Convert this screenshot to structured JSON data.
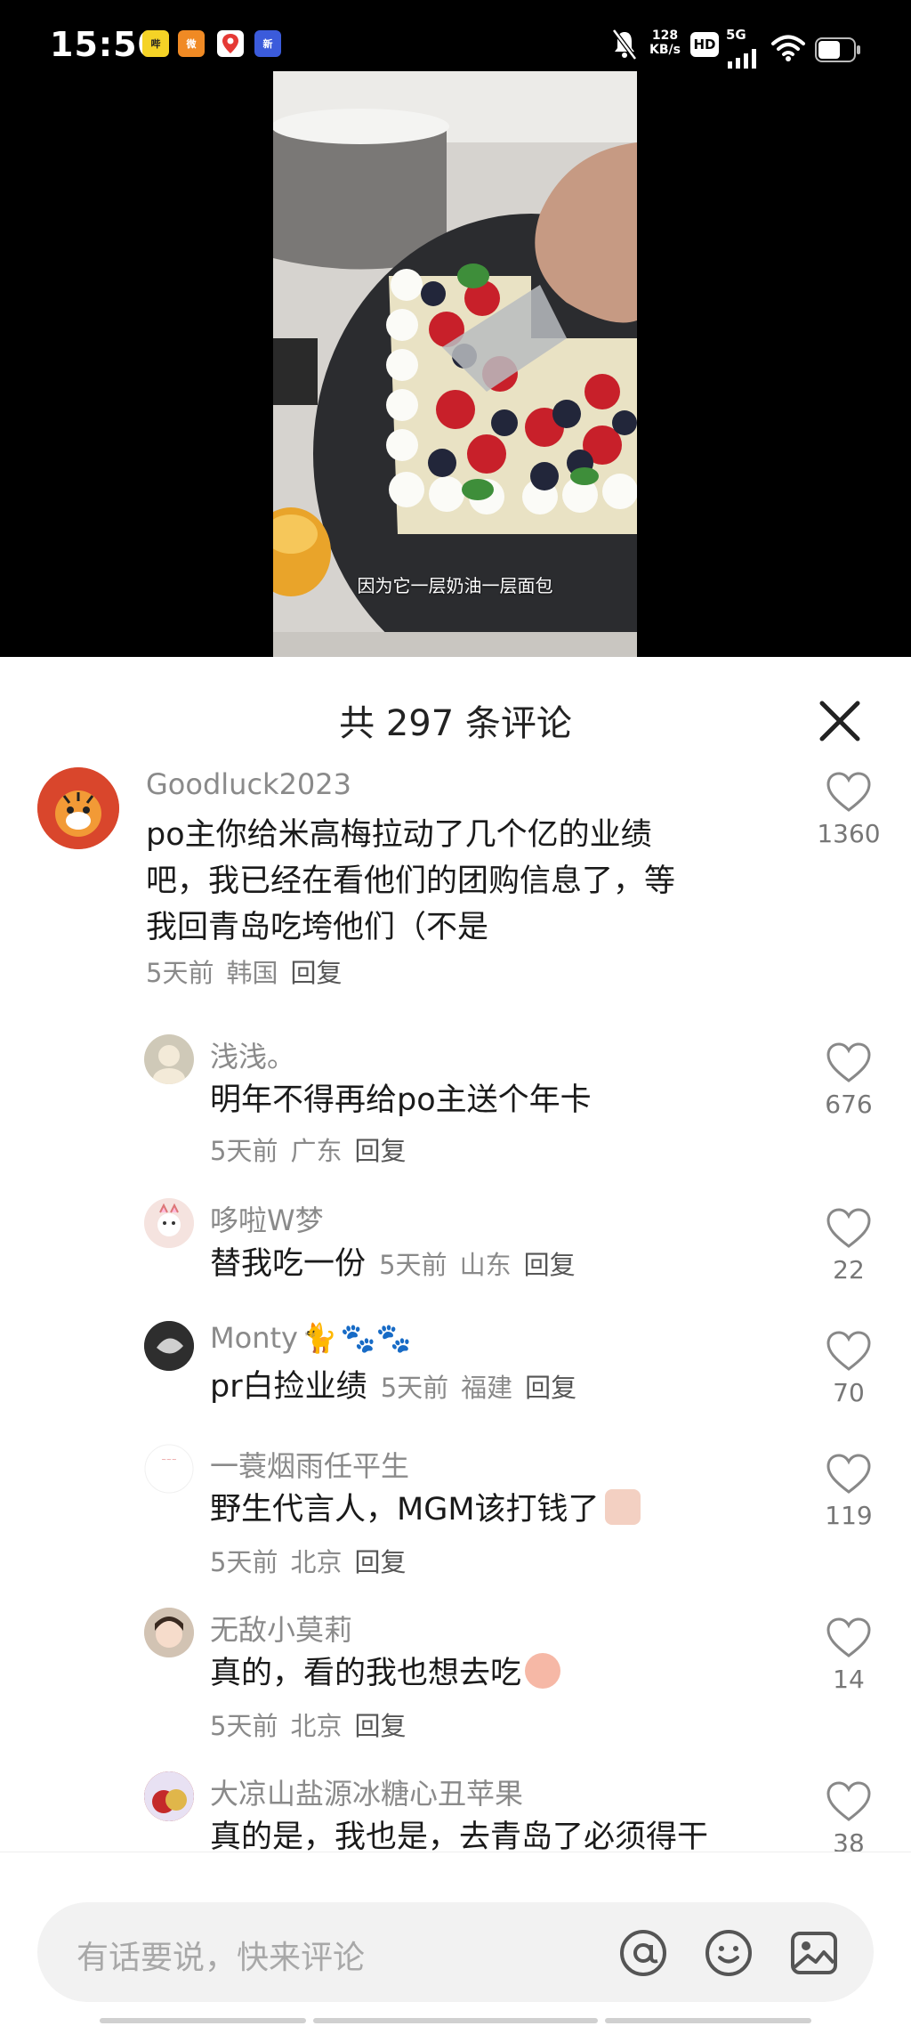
{
  "status_bar": {
    "time": "15:50",
    "app_icons": [
      "bilibili-icon",
      "weibo-icon",
      "map-pin-icon",
      "app-icon"
    ],
    "net_speed_value": "128",
    "net_speed_unit": "KB/s",
    "hd_label": "HD",
    "signal_label": "5G"
  },
  "video": {
    "caption": "因为它一层奶油一层面包"
  },
  "comments_header": {
    "title": "共 297 条评论"
  },
  "comments": [
    {
      "username": "Goodluck2023",
      "text_lines": [
        "po主你给米高梅拉动了几个亿的业绩",
        "吧，我已经在看他们的团购信息了，等",
        "我回青岛吃垮他们（不是"
      ],
      "time": "5天前",
      "location": "韩国",
      "reply": "回复",
      "likes": "1360"
    },
    {
      "username": "浅浅。",
      "text": "明年不得再给po主送个年卡",
      "time": "5天前",
      "location": "广东",
      "reply": "回复",
      "likes": "676"
    },
    {
      "username": "哆啦W梦",
      "text": "替我吃一份",
      "time": "5天前",
      "location": "山东",
      "reply": "回复",
      "likes": "22"
    },
    {
      "username": "Monty",
      "text": "pr白捡业绩",
      "time": "5天前",
      "location": "福建",
      "reply": "回复",
      "likes": "70"
    },
    {
      "username": "一蓑烟雨任平生",
      "text": "野生代言人，MGM该打钱了",
      "time": "5天前",
      "location": "北京",
      "reply": "回复",
      "likes": "119"
    },
    {
      "username": "无敌小莫莉",
      "text": "真的，看的我也想去吃",
      "time": "5天前",
      "location": "北京",
      "reply": "回复",
      "likes": "14"
    },
    {
      "username": "大凉山盐源冰糖心丑苹果",
      "text": "真的是，我也是，去青岛了必须得干",
      "likes": "38"
    }
  ],
  "input_bar": {
    "placeholder": "有话要说，快来评论"
  },
  "colors": {
    "video_bg": "#000000",
    "text_primary": "#1a1a1a",
    "text_secondary": "#8a8a8a",
    "input_bg": "#f2f2f2"
  }
}
